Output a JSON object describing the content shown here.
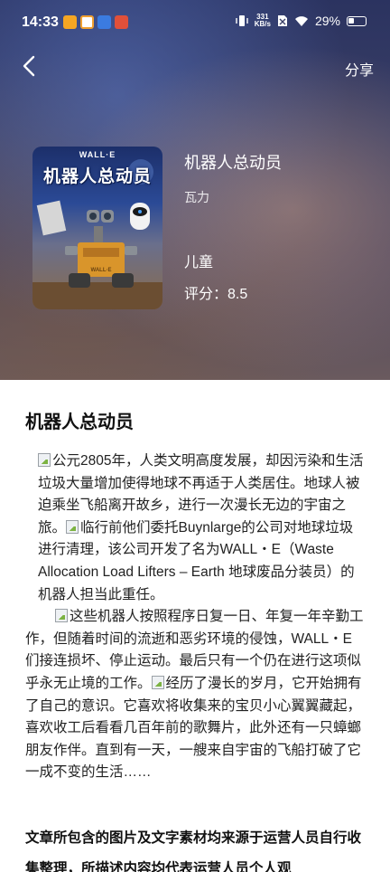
{
  "status_bar": {
    "time": "14:33",
    "net_speed_value": "331",
    "net_speed_unit": "KB/s",
    "battery": "29%"
  },
  "nav": {
    "share_label": "分享"
  },
  "poster": {
    "brand": "WALL·E",
    "title": "机器人总动员"
  },
  "movie": {
    "title": "机器人总动员",
    "director": "瓦力",
    "genre": "儿童",
    "rating": "评分：8.5"
  },
  "content": {
    "title": "机器人总动员",
    "p1_s1": "公元2805年，人类文明高度发展，却因污染和生活垃圾大量增加使得地球不再适于人类居住。地球人被迫乘坐飞船离开故乡，进行一次漫长无边的宇宙之旅。",
    "p1_s2": "临行前他们委托Buynlarge的公司对地球垃圾进行清理，该公司开发了名为WALL・E（Waste Allocation Load Lifters – Earth 地球废品分装员）的机器人担当此重任。",
    "p2_s1": "这些机器人按照程序日复一日、年复一年辛勤工作，但随着时间的流逝和恶劣环境的侵蚀，WALL・E们接连损坏、停止运动。最后只有一个仍在进行这项似乎永无止境的工作。",
    "p2_s2": "经历了漫长的岁月，它开始拥有了自己的意识。它喜欢将收集来的宝贝小心翼翼藏起，喜欢收工后看看几百年前的歌舞片，此外还有一只蟑螂朋友作伴。直到有一天，一艘来自宇宙的飞船打破了它一成不变的生活……",
    "disclaimer": "文章所包含的图片及文字素材均来源于运营人员自行收集整理，所描述内容均代表运营人员个人观"
  }
}
